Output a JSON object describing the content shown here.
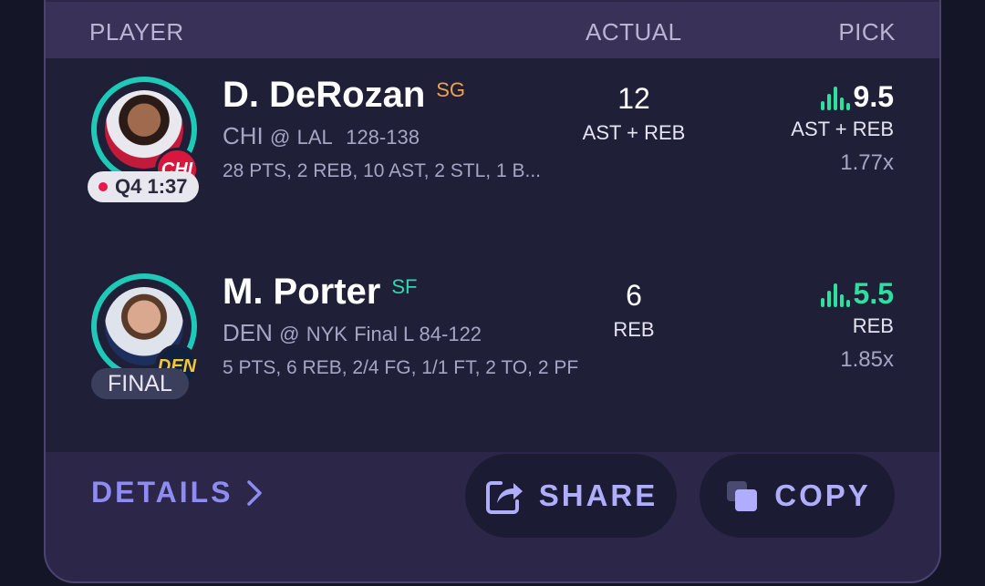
{
  "header": {
    "player": "PLAYER",
    "actual": "ACTUAL",
    "pick": "PICK"
  },
  "rows": [
    {
      "name": "D. DeRozan",
      "position": "SG",
      "team": "CHI",
      "at": "@",
      "opponent": "LAL",
      "score": "128-138",
      "team_badge": "CHI",
      "status": "Q4 1:37",
      "statline": "28 PTS, 2 REB, 10 AST, 2 STL, 1 B...",
      "actual_value": "12",
      "actual_label": "AST + REB",
      "pick_value": "9.5",
      "pick_label": "AST + REB",
      "multiplier": "1.77x"
    },
    {
      "name": "M. Porter",
      "position": "SF",
      "team": "DEN",
      "at": "@",
      "opponent": "NYK",
      "score": "Final L 84-122",
      "team_badge": "DEN",
      "status": "FINAL",
      "statline": "5 PTS, 6 REB, 2/4 FG, 1/1 FT, 2 TO, 2 PF",
      "actual_value": "6",
      "actual_label": "REB",
      "pick_value": "5.5",
      "pick_label": "REB",
      "multiplier": "1.85x"
    }
  ],
  "footer": {
    "details": "DETAILS",
    "share": "SHARE",
    "copy": "COPY"
  },
  "colors": {
    "ring": "#1ec9b7",
    "accent": "#8e8cf2",
    "pick_green": "#2ee0a0"
  },
  "icons": [
    "live-dot-icon",
    "signal-bars-icon",
    "chevron-right-icon",
    "share-icon",
    "copy-icon"
  ]
}
